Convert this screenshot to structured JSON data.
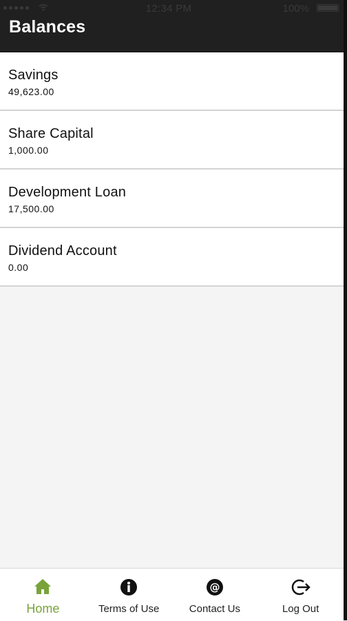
{
  "status_bar": {
    "time": "12:34 PM",
    "battery_percent": "100%"
  },
  "header": {
    "title": "Balances"
  },
  "balances": [
    {
      "label": "Savings",
      "value": "49,623.00"
    },
    {
      "label": "Share Capital",
      "value": "1,000.00"
    },
    {
      "label": "Development Loan",
      "value": "17,500.00"
    },
    {
      "label": "Dividend Account",
      "value": "0.00"
    }
  ],
  "tabs": [
    {
      "label": "Home",
      "icon": "home-icon",
      "active": true
    },
    {
      "label": "Terms of Use",
      "icon": "info-icon",
      "active": false
    },
    {
      "label": "Contact Us",
      "icon": "at-icon",
      "active": false
    },
    {
      "label": "Log Out",
      "icon": "logout-icon",
      "active": false
    }
  ],
  "colors": {
    "header": "#202020",
    "accent": "#79a33a",
    "background": "#f4f4f4"
  }
}
